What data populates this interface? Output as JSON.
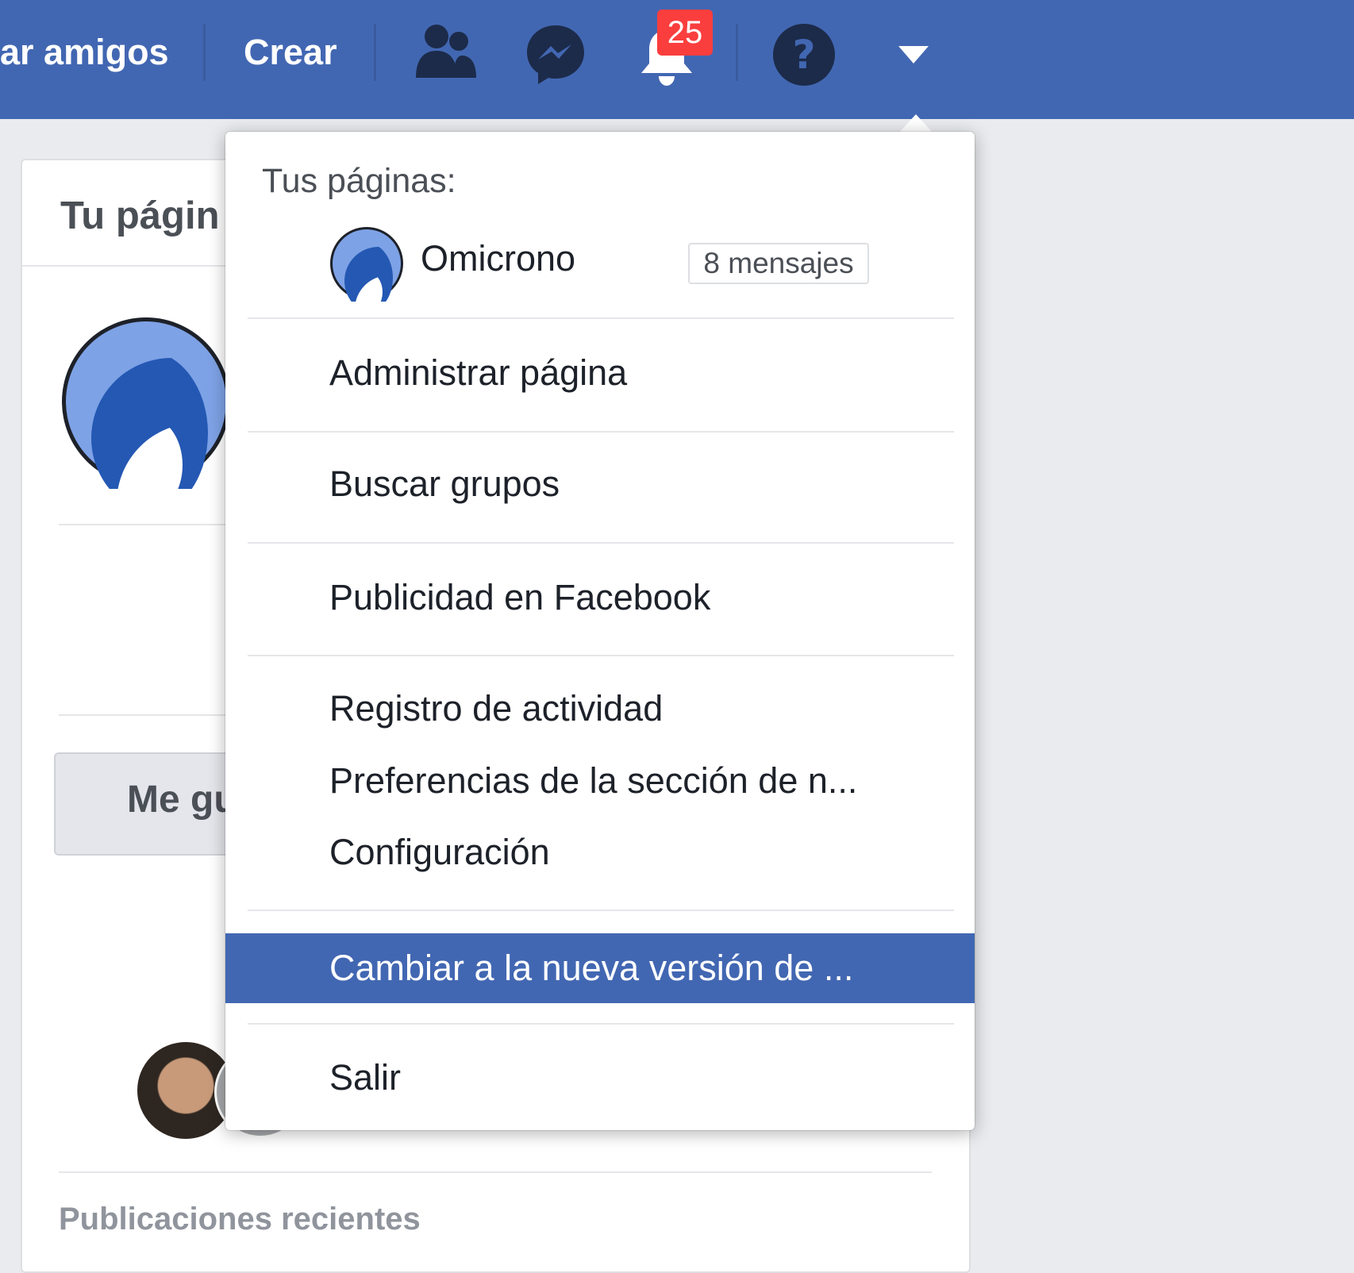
{
  "topbar": {
    "find_friends_label": "ar amigos",
    "create_label": "Crear",
    "notification_count": "25",
    "colors": {
      "bar": "#4267b2",
      "badge": "#fa3e3e",
      "icon": "#1c2b4a"
    }
  },
  "background_page": {
    "title": "Tu págin",
    "like_button_label": "Me gu",
    "recent_posts_label": "Publicaciones recientes"
  },
  "dropdown": {
    "pages_heading": "Tus páginas:",
    "page": {
      "name": "Omicrono",
      "messages_badge": "8 mensajes"
    },
    "items": [
      "Administrar página",
      "Buscar grupos",
      "Publicidad en Facebook",
      "Registro de actividad",
      "Preferencias de la sección de n...",
      "Configuración"
    ],
    "highlighted_item": "Cambiar a la nueva versión de ...",
    "logout_label": "Salir",
    "colors": {
      "highlight": "#4267b2",
      "avatar_outer": "#7ea2e6",
      "avatar_inner": "#2458b3"
    }
  }
}
